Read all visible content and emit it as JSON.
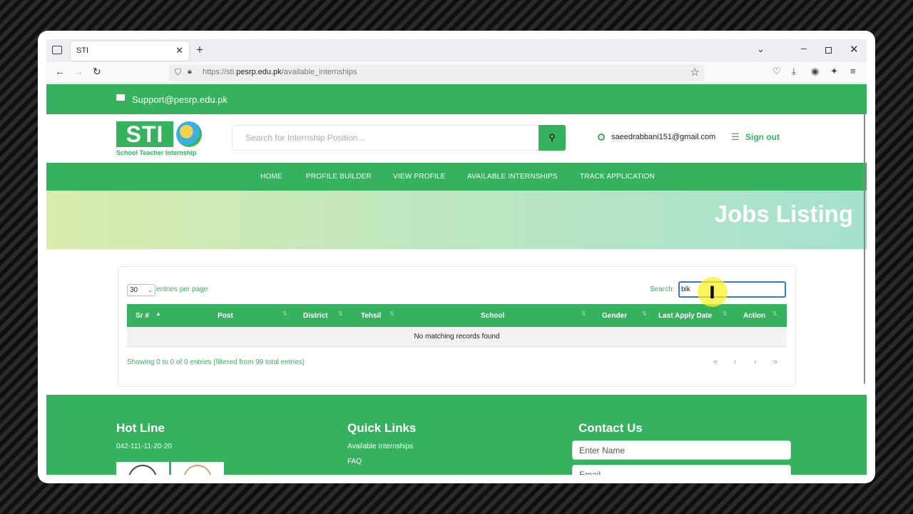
{
  "browser": {
    "tab_title": "STI",
    "url_prefix": "https://sti.",
    "url_domain": "pesrp.edu.pk",
    "url_path": "/available_internships"
  },
  "topbar": {
    "support_email": "Support@pesrp.edu.pk"
  },
  "header": {
    "logo_text": "STI",
    "logo_subtitle": "School Teacher Internship",
    "search_placeholder": "Search for Internship Position...",
    "user_email": "saeedrabbani151@gmail.com",
    "signout_label": "Sign out"
  },
  "nav": {
    "items": [
      "HOME",
      "PROFILE BUILDER",
      "VIEW PROFILE",
      "AVAILABLE INTERNSHIPS",
      "TRACK APPLICATION"
    ]
  },
  "banner": {
    "title": "Jobs Listing"
  },
  "table": {
    "entries_value": "30",
    "entries_label": "entries per page",
    "search_label": "Search:",
    "search_value": "bik",
    "columns": [
      "Sr #",
      "Post",
      "District",
      "Tehsil",
      "School",
      "Gender",
      "Last Apply Date",
      "Action"
    ],
    "empty_message": "No matching records found",
    "info": "Showing 0 to 0 of 0 entries (filtered from 99 total entries)",
    "pagination": [
      "«",
      "‹",
      "›",
      "»"
    ]
  },
  "footer": {
    "hotline_title": "Hot Line",
    "hotline_number": "042-111-11-20-20",
    "quicklinks_title": "Quick Links",
    "links": [
      "Available Internships",
      "FAQ"
    ],
    "contact_title": "Contact Us",
    "name_placeholder": "Enter Name",
    "email_placeholder": "Email"
  },
  "colors": {
    "brand_green": "#36b15e",
    "focus_blue": "#3b76c9"
  }
}
